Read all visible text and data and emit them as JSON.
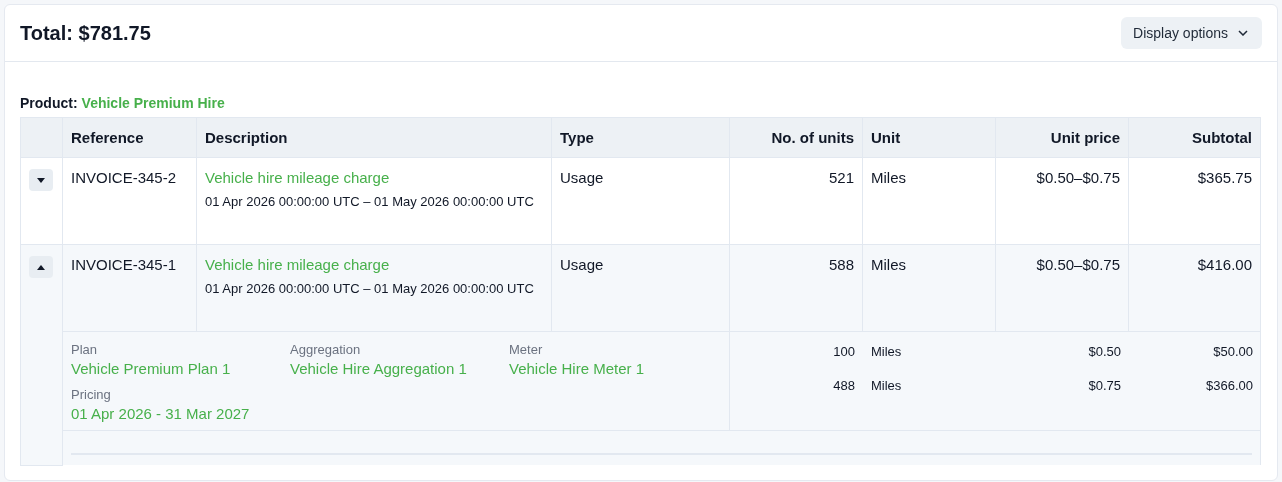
{
  "header": {
    "total": "Total: $781.75",
    "display_options": "Display options"
  },
  "product": {
    "label": "Product:",
    "name": "Vehicle Premium Hire"
  },
  "table": {
    "columns": [
      "Reference",
      "Description",
      "Type",
      "No. of units",
      "Unit",
      "Unit price",
      "Subtotal"
    ],
    "rows": [
      {
        "expanded": false,
        "reference": "INVOICE-345-2",
        "description": "Vehicle hire mileage charge",
        "period": "01 Apr 2026 00:00:00 UTC – 01 May 2026 00:00:00 UTC",
        "type": "Usage",
        "units": "521",
        "unit": "Miles",
        "unit_price": "$0.50–$0.75",
        "subtotal": "$365.75"
      },
      {
        "expanded": true,
        "reference": "INVOICE-345-1",
        "description": "Vehicle hire mileage charge",
        "period": "01 Apr 2026 00:00:00 UTC – 01 May 2026 00:00:00 UTC",
        "type": "Usage",
        "units": "588",
        "unit": "Miles",
        "unit_price": "$0.50–$0.75",
        "subtotal": "$416.00",
        "details": [
          {
            "label": "Plan",
            "value": "Vehicle Premium Plan 1"
          },
          {
            "label": "Aggregation",
            "value": "Vehicle Hire Aggregation 1"
          },
          {
            "label": "Meter",
            "value": "Vehicle Hire Meter 1"
          },
          {
            "label": "Pricing",
            "value": "01 Apr 2026 - 31 Mar 2027"
          }
        ],
        "tiers": [
          {
            "units": "100",
            "unit": "Miles",
            "unit_price": "$0.50",
            "subtotal": "$50.00"
          },
          {
            "units": "488",
            "unit": "Miles",
            "unit_price": "$0.75",
            "subtotal": "$366.00"
          }
        ]
      }
    ]
  }
}
